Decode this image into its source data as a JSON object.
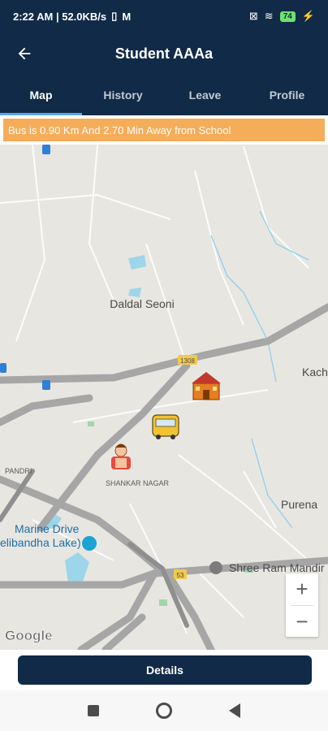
{
  "status_bar": {
    "time_speed": "2:22 AM | 52.0KB/s",
    "battery": "74"
  },
  "app_bar": {
    "title": "Student AAAa"
  },
  "tabs": [
    {
      "label": "Map",
      "active": true
    },
    {
      "label": "History",
      "active": false
    },
    {
      "label": "Leave",
      "active": false
    },
    {
      "label": "Profile",
      "active": false
    }
  ],
  "banner_text": "Bus is 0.90 Km And 2.70 Min Away from School",
  "map": {
    "places": [
      "Daldal Seoni",
      "Kach",
      "Purena",
      "SHANKAR NAGAR",
      "PANDRI",
      "Marine Drive",
      "elibandha Lake)",
      "Shree Ram Mandir"
    ],
    "road_badges": [
      "1308",
      "53"
    ],
    "attribution": "Google",
    "zoom_in": "+",
    "zoom_out": "−"
  },
  "details_button": "Details",
  "colors": {
    "primary": "#102a47",
    "banner": "#f6ad5a",
    "tab_indicator": "#5aa6e6"
  }
}
